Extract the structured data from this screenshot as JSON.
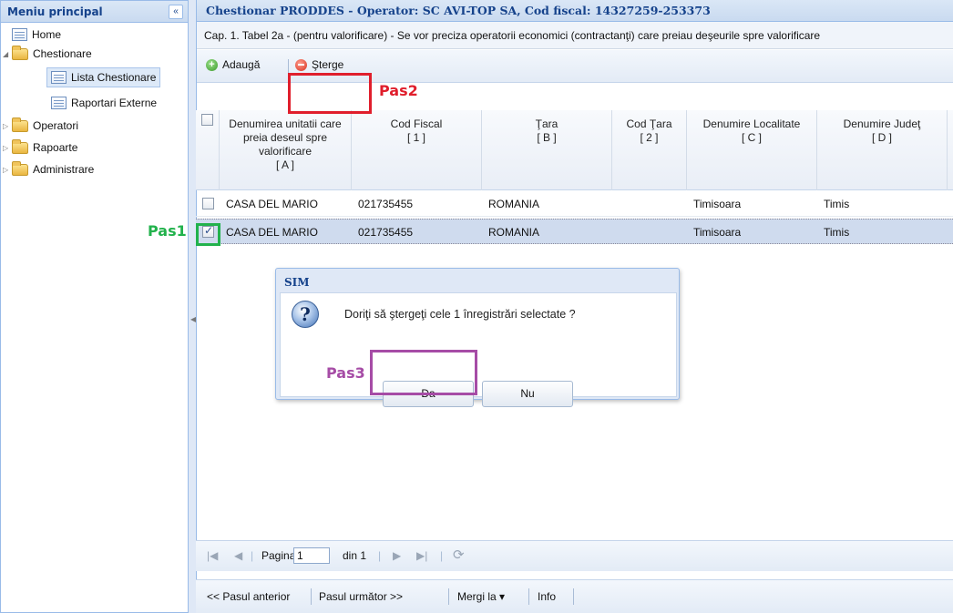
{
  "sidebar": {
    "title": "Meniu principal",
    "collapse_glyph": "«",
    "items": [
      {
        "label": "Home",
        "icon": "page-icon"
      },
      {
        "label": "Chestionare",
        "icon": "folder-icon",
        "expanded": true
      },
      {
        "label": "Lista Chestionare",
        "icon": "page-icon",
        "selected": true
      },
      {
        "label": "Raportari Externe",
        "icon": "page-icon"
      },
      {
        "label": "Operatori",
        "icon": "folder-icon"
      },
      {
        "label": "Rapoarte",
        "icon": "folder-icon"
      },
      {
        "label": "Administrare",
        "icon": "folder-icon"
      }
    ]
  },
  "main": {
    "title": "Chestionar PRODDES - Operator: SC AVI-TOP SA, Cod fiscal: 14327259-253373",
    "description": "Cap. 1. Tabel 2a - (pentru valorificare) - Se vor preciza operatorii economici (contractanţi) care preiau deşeurile spre valorificare"
  },
  "toolbar": {
    "add_label": "Adaugă",
    "delete_label": "Şterge"
  },
  "grid": {
    "columns": [
      {
        "line1": "Denumirea unitatii care preia deseul spre valorificare",
        "line2": "[ A ]"
      },
      {
        "line1": "Cod Fiscal",
        "line2": "[ 1 ]"
      },
      {
        "line1": "Ţara",
        "line2": "[ B ]"
      },
      {
        "line1": "Cod Ţara",
        "line2": "[ 2 ]"
      },
      {
        "line1": "Denumire Localitate",
        "line2": "[ C ]"
      },
      {
        "line1": "Denumire Judeţ",
        "line2": "[ D ]"
      }
    ],
    "rows": [
      {
        "checked": false,
        "denumire": "CASA DEL MARIO",
        "cod_fiscal": "021735455",
        "tara": "ROMANIA",
        "cod_tara": "",
        "localitate": "Timisoara",
        "judet": "Timis"
      },
      {
        "checked": true,
        "denumire": "CASA DEL MARIO",
        "cod_fiscal": "021735455",
        "tara": "ROMANIA",
        "cod_tara": "",
        "localitate": "Timisoara",
        "judet": "Timis"
      }
    ]
  },
  "dialog": {
    "title": "SIM",
    "message": "Doriţi să ştergeţi cele 1 înregistrări selectate ?",
    "yes_label": "Da",
    "no_label": "Nu"
  },
  "pager": {
    "page_label": "Pagina",
    "page_value": "1",
    "of_label": "din 1"
  },
  "bottom_bar": {
    "prev_label": "<< Pasul anterior",
    "next_label": "Pasul următor >>",
    "goto_label": "Mergi la ▾",
    "info_label": "Info"
  },
  "annotations": {
    "pas1": "Pas1",
    "pas2": "Pas2",
    "pas3": "Pas3",
    "pas1_color": "#22b24c",
    "pas2_color": "#e01e2c",
    "pas3_color": "#a64ca6"
  }
}
